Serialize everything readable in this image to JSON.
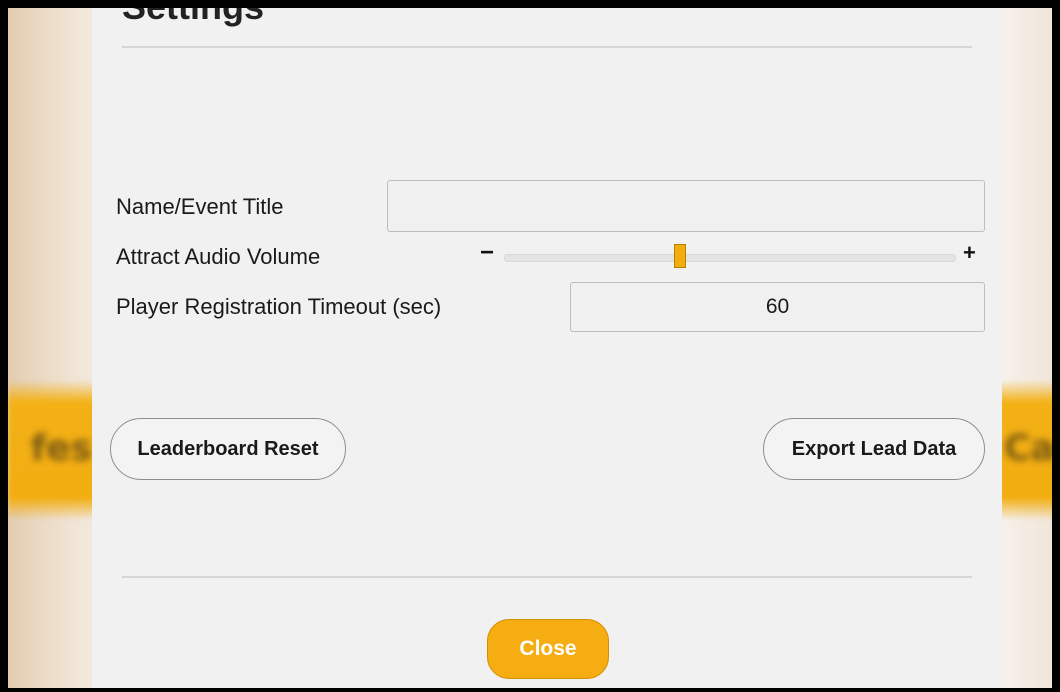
{
  "dialog": {
    "title": "Settings",
    "fields": {
      "name_label": "Name/Event Title",
      "name_value": "",
      "volume_label": "Attract Audio Volume",
      "volume_level": 0.39,
      "volume_minus": "−",
      "volume_plus": "+",
      "timeout_label": "Player Registration Timeout (sec)",
      "timeout_value": "60"
    },
    "buttons": {
      "reset_label": "Leaderboard Reset",
      "export_label": "Export Lead Data",
      "close_label": "Close"
    }
  },
  "background": {
    "left_text": "fes",
    "right_text": "Can"
  },
  "colors": {
    "accent": "#f5ad12",
    "panel": "#f1f1f1"
  }
}
